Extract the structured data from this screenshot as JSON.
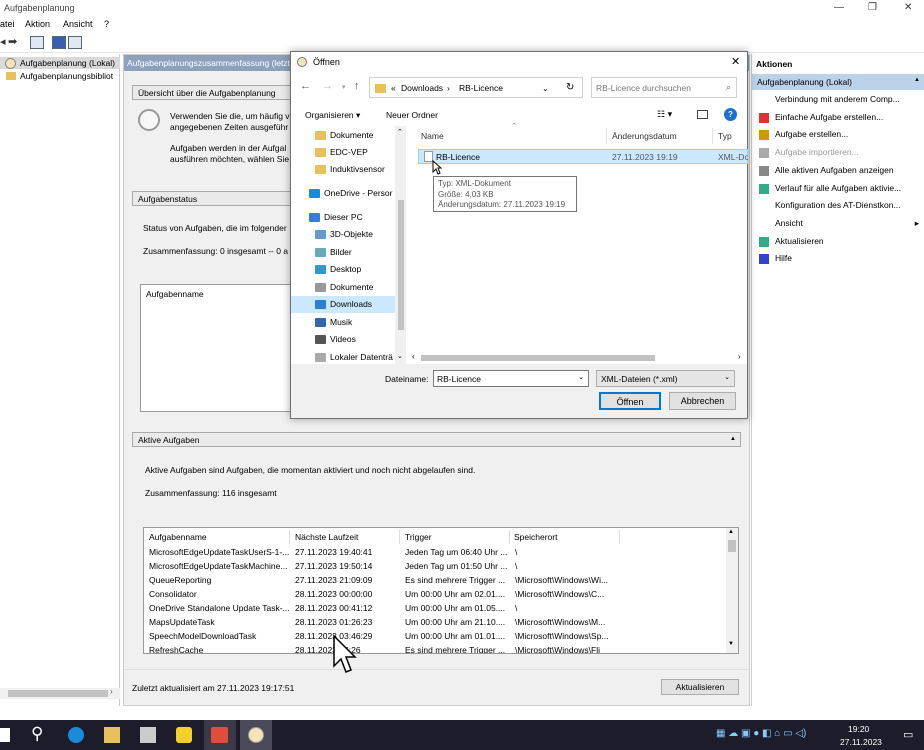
{
  "app": {
    "title": "Aufgabenplanung",
    "menu": [
      "atei",
      "Aktion",
      "Ansicht",
      "?"
    ]
  },
  "tree": {
    "items": [
      "Aufgabenplanung (Lokal)",
      "Aufgabenplanungsbibliot"
    ]
  },
  "middle": {
    "header": "Aufgabenplanungszusammenfassung (letzt",
    "overview": {
      "heading": "Übersicht über die Aufgabenplanung",
      "text1_l1": "Verwenden Sie die, um häufig v",
      "text1_l2": "angegebenen Zeiten ausgeführ",
      "text2_l1": "Aufgaben werden in der Aufgal",
      "text2_l2": "ausführen möchten, wählen Sie"
    },
    "status": {
      "heading": "Aufgabenstatus",
      "line1": "Status von Aufgaben, die im folgender",
      "line2": "Zusammenfassung: 0 insgesamt -- 0 a",
      "col": "Aufgabenname"
    },
    "active": {
      "heading": "Aktive Aufgaben",
      "desc": "Aktive Aufgaben sind Aufgaben, die momentan aktiviert und noch nicht abgelaufen sind.",
      "summary": "Zusammenfassung: 116 insgesamt",
      "columns": [
        "Aufgabenname",
        "Nächste Laufzeit",
        "Trigger",
        "Speicherort"
      ],
      "rows": [
        [
          "MicrosoftEdgeUpdateTaskUserS-1-...",
          "27.11.2023 19:40:41",
          "Jeden Tag um 06:40 Uhr ...",
          "\\"
        ],
        [
          "MicrosoftEdgeUpdateTaskMachine...",
          "27.11.2023 19:50:14",
          "Jeden Tag um 01:50 Uhr ...",
          "\\"
        ],
        [
          "QueueReporting",
          "27.11.2023 21:09:09",
          "Es sind mehrere Trigger ...",
          "\\Microsoft\\Windows\\Wi..."
        ],
        [
          "Consolidator",
          "28.11.2023 00:00:00",
          "Um 00:00 Uhr am 02.01....",
          "\\Microsoft\\Windows\\C..."
        ],
        [
          "OneDrive Standalone Update Task-...",
          "28.11.2023 00:41:12",
          "Um 00:00 Uhr am 01.05....",
          "\\"
        ],
        [
          "MapsUpdateTask",
          "28.11.2023 01:26:23",
          "Um 00:00 Uhr am 21.10....",
          "\\Microsoft\\Windows\\M..."
        ],
        [
          "SpeechModelDownloadTask",
          "28.11.2023 03:46:29",
          "Um 00:00 Uhr am 01.01....",
          "\\Microsoft\\Windows\\Sp..."
        ],
        [
          "RefreshCache",
          "28.11.2023 06:26",
          "Es sind mehrere Trigger ...",
          "\\Microsoft\\Windows\\Fli"
        ]
      ]
    },
    "footer": {
      "updated": "Zuletzt aktualisiert am 27.11.2023 19:17:51",
      "refresh": "Aktualisieren"
    }
  },
  "actions": {
    "title": "Aktionen",
    "section": "Aufgabenplanung (Lokal)",
    "items": [
      "Verbindung mit anderem Comp...",
      "Einfache Aufgabe erstellen...",
      "Aufgabe erstellen...",
      "Aufgabe importieren...",
      "Alle aktiven Aufgaben anzeigen",
      "Verlauf für alle Aufgaben aktivie...",
      "Konfiguration des AT-Dienstkon...",
      "Ansicht",
      "Aktualisieren",
      "Hilfe"
    ]
  },
  "dialog": {
    "title": "Öffnen",
    "path_prefix": "«",
    "path": [
      "Downloads",
      "RB-Licence"
    ],
    "search_placeholder": "RB-Licence durchsuchen",
    "organize": "Organisieren ▾",
    "new_folder": "Neuer Ordner",
    "nav": [
      "Dokumente",
      "EDC-VEP",
      "Induktivsensor",
      "OneDrive - Persor",
      "Dieser PC",
      "3D-Objekte",
      "Bilder",
      "Desktop",
      "Dokumente",
      "Downloads",
      "Musik",
      "Videos",
      "Lokaler Datenträ"
    ],
    "columns": [
      "Name",
      "Änderungsdatum",
      "Typ"
    ],
    "file": {
      "name": "RB-Licence",
      "date": "27.11.2023 19:19",
      "type": "XML-Do"
    },
    "tooltip": [
      "Typ: XML-Dokument",
      "Größe: 4,03 KB",
      "Änderungsdatum: 27.11.2023 19:19"
    ],
    "filename_label": "Dateiname:",
    "filename_value": "RB-Licence",
    "filetype": "XML-Dateien (*.xml)",
    "open": "Öffnen",
    "cancel": "Abbrechen"
  },
  "taskbar": {
    "time": "19:20",
    "date": "27.11.2023"
  }
}
